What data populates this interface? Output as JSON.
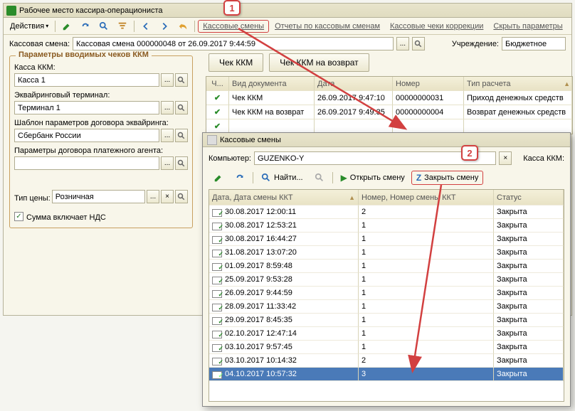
{
  "window": {
    "title": "Рабочее место кассира-операциониста"
  },
  "toolbar": {
    "actions": "Действия",
    "link_shifts": "Кассовые смены",
    "link_reports": "Отчеты по кассовым сменам",
    "link_correction": "Кассовые чеки коррекции",
    "link_hide_params": "Скрыть параметры"
  },
  "header": {
    "shift_label": "Кассовая смена:",
    "shift_value": "Кассовая смена 000000048 от 26.09.2017 9:44:59",
    "org_label": "Учреждение:",
    "org_value": "Бюджетное"
  },
  "params": {
    "title": "Параметры вводимых чеков ККМ",
    "kkm_label": "Касса ККМ:",
    "kkm_value": "Касса 1",
    "acq_label": "Эквайринговый терминал:",
    "acq_value": "Терминал 1",
    "tmpl_label": "Шаблон параметров договора эквайринга:",
    "tmpl_value": "Сбербанк России",
    "agent_label": "Параметры договора платежного агента:",
    "agent_value": "",
    "price_label": "Тип цены:",
    "price_value": "Розничная",
    "vat_label": "Сумма включает НДС"
  },
  "big_buttons": {
    "receipt": "Чек ККМ",
    "refund": "Чек ККМ на возврат"
  },
  "doc_columns": {
    "chk": "Ч...",
    "type": "Вид документа",
    "date": "Дата",
    "num": "Номер",
    "pay": "Тип расчета"
  },
  "docs": [
    {
      "type": "Чек ККМ",
      "date": "26.09.2017 9:47:10",
      "num": "00000000031",
      "pay": "Приход денежных средств"
    },
    {
      "type": "Чек ККМ на возврат",
      "date": "26.09.2017 9:49:35",
      "num": "00000000004",
      "pay": "Возврат денежных средств"
    }
  ],
  "popup": {
    "title": "Кассовые смены",
    "computer_label": "Компьютер:",
    "computer_value": "GUZENKO-Y",
    "kkm_label": "Касса ККМ:",
    "find": "Найти...",
    "open_shift": "Открыть смену",
    "close_shift": "Закрыть смену",
    "columns": {
      "date": "Дата, Дата смены ККТ",
      "num": "Номер, Номер смены ККТ",
      "status": "Статус"
    },
    "rows": [
      {
        "date": "30.08.2017 12:00:11",
        "num": "2",
        "status": "Закрыта"
      },
      {
        "date": "30.08.2017 12:53:21",
        "num": "1",
        "status": "Закрыта"
      },
      {
        "date": "30.08.2017 16:44:27",
        "num": "1",
        "status": "Закрыта"
      },
      {
        "date": "31.08.2017 13:07:20",
        "num": "1",
        "status": "Закрыта"
      },
      {
        "date": "01.09.2017 8:59:48",
        "num": "1",
        "status": "Закрыта"
      },
      {
        "date": "25.09.2017 9:53:28",
        "num": "1",
        "status": "Закрыта"
      },
      {
        "date": "26.09.2017 9:44:59",
        "num": "1",
        "status": "Закрыта"
      },
      {
        "date": "28.09.2017 11:33:42",
        "num": "1",
        "status": "Закрыта"
      },
      {
        "date": "29.09.2017 8:45:35",
        "num": "1",
        "status": "Закрыта"
      },
      {
        "date": "02.10.2017 12:47:14",
        "num": "1",
        "status": "Закрыта"
      },
      {
        "date": "03.10.2017 9:57:45",
        "num": "1",
        "status": "Закрыта"
      },
      {
        "date": "03.10.2017 10:14:32",
        "num": "2",
        "status": "Закрыта"
      },
      {
        "date": "04.10.2017 10:57:32",
        "num": "3",
        "status": "Закрыта"
      }
    ]
  },
  "callouts": {
    "one": "1",
    "two": "2"
  }
}
